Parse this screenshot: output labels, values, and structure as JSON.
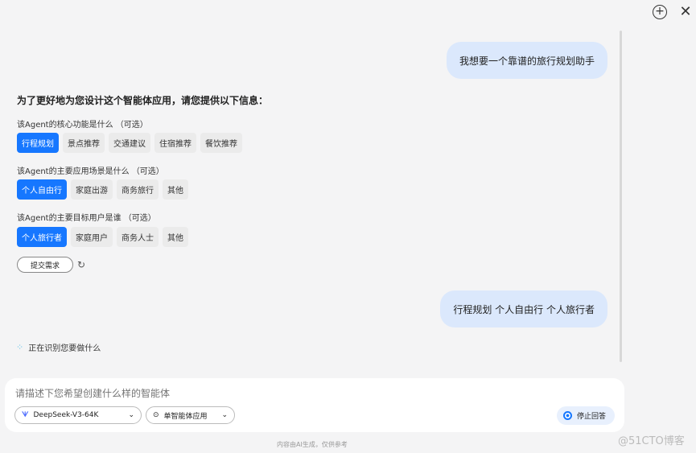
{
  "header": {
    "new_chat_icon": "plus-circle-icon",
    "close_icon": "close-icon"
  },
  "messages": {
    "user1": "我想要一个靠谱的旅行规划助手",
    "user2": "行程规划 个人自由行 个人旅行者"
  },
  "form": {
    "title": "为了更好地为您设计这个智能体应用，请您提供以下信息：",
    "questions": [
      {
        "label": "该Agent的核心功能是什么 （可选）",
        "options": [
          "行程规划",
          "景点推荐",
          "交通建议",
          "住宿推荐",
          "餐饮推荐"
        ],
        "selected": 0
      },
      {
        "label": "该Agent的主要应用场景是什么 （可选）",
        "options": [
          "个人自由行",
          "家庭出游",
          "商务旅行",
          "其他"
        ],
        "selected": 0
      },
      {
        "label": "该Agent的主要目标用户是谁 （可选）",
        "options": [
          "个人旅行者",
          "家庭用户",
          "商务人士",
          "其他"
        ],
        "selected": 0
      }
    ],
    "submit": "提交需求"
  },
  "status": "正在识别您要做什么",
  "input": {
    "placeholder": "请描述下您希望创建什么样的智能体",
    "model": "DeepSeek-V3-64K",
    "mode": "单智能体应用",
    "stop": "停止回答"
  },
  "footer": "内容由AI生成，仅供参考",
  "watermark": "@51CTO博客",
  "colors": {
    "accent": "#1677ff",
    "bubble": "#dbe8fc"
  }
}
